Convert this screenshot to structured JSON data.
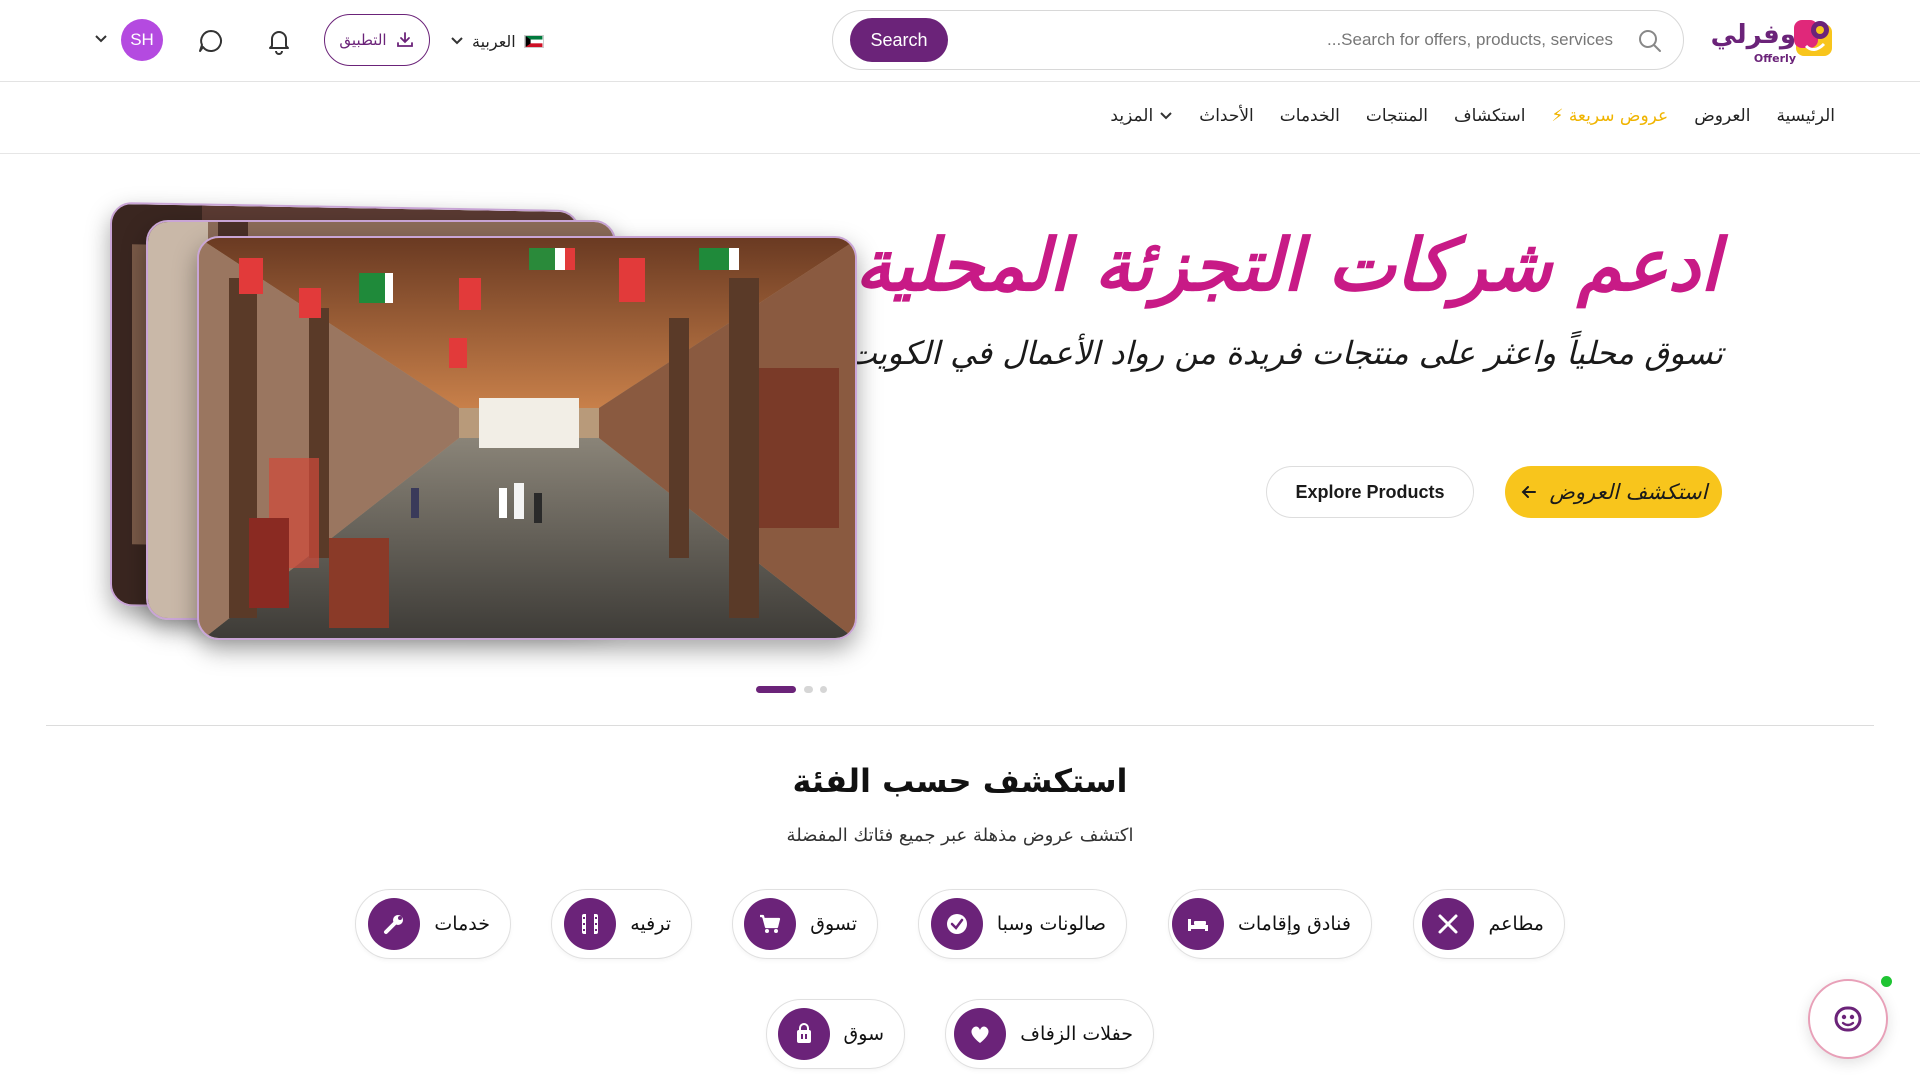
{
  "header": {
    "logo_text": "وفرلي",
    "logo_sub": "Offerly",
    "search": {
      "placeholder": "...Search for offers, products, services",
      "button_label": "Search"
    },
    "language_label": "العربية",
    "app_button_label": "التطبيق",
    "avatar_initials": "SH"
  },
  "nav": {
    "items": [
      {
        "label": "الرئيسية"
      },
      {
        "label": "العروض"
      },
      {
        "label": "⚡ عروض سريعة"
      },
      {
        "label": "استكشاف"
      },
      {
        "label": "المنتجات"
      },
      {
        "label": "الخدمات"
      },
      {
        "label": "الأحداث"
      },
      {
        "label": "المزيد"
      }
    ]
  },
  "hero": {
    "title": "ادعم شركات التجزئة المحلية",
    "subtitle": "تسوق محلياً واعثر على منتجات فريدة من رواد الأعمال في الكويت",
    "primary_button": "استكشف العروض",
    "secondary_button": "Explore Products",
    "slides_total": 3,
    "active_slide": 1
  },
  "categories": {
    "title": "استكشف حسب الفئة",
    "subtitle": "اكتشف عروض مذهلة عبر جميع فئاتك المفضلة",
    "items": [
      {
        "label": "مطاعم",
        "icon": "utensils-icon"
      },
      {
        "label": "فنادق وإقامات",
        "icon": "bed-icon"
      },
      {
        "label": "صالونات وسبا",
        "icon": "check-badge-icon"
      },
      {
        "label": "تسوق",
        "icon": "cart-icon"
      },
      {
        "label": "ترفيه",
        "icon": "film-icon"
      },
      {
        "label": "خدمات",
        "icon": "wrench-icon"
      },
      {
        "label": "حفلات الزفاف",
        "icon": "heart-icon"
      },
      {
        "label": "سوق",
        "icon": "shopping-bag-icon"
      }
    ]
  },
  "colors": {
    "brand_purple": "#6b2379",
    "brand_pink": "#c81a86",
    "accent_yellow": "#f8c51c",
    "flash_yellow": "#f0b400",
    "avatar_purple": "#b44ae0",
    "online_green": "#1fc433"
  }
}
